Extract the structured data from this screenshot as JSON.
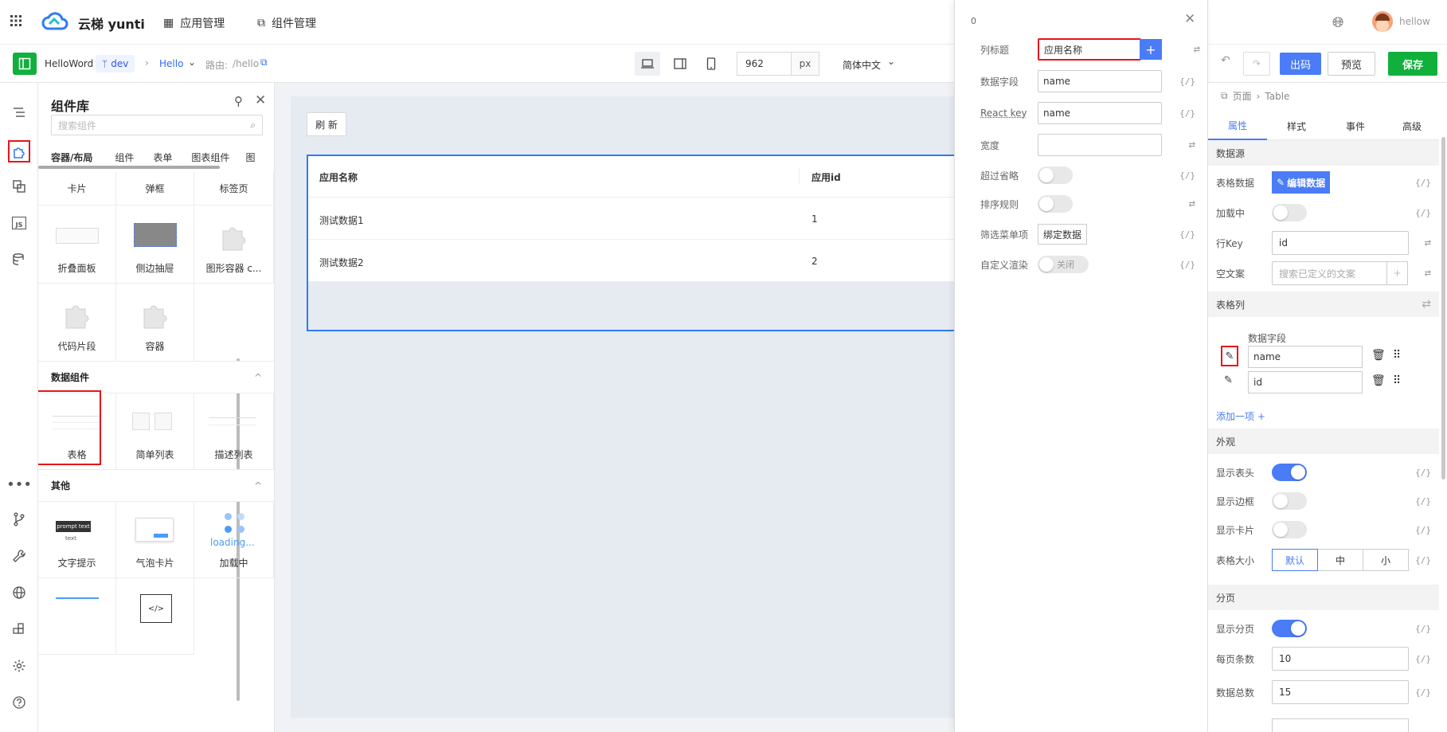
{
  "header": {
    "brand": "云梯 yunti",
    "nav": [
      {
        "label": "应用管理"
      },
      {
        "label": "组件管理"
      }
    ],
    "user": "hellow"
  },
  "subbar": {
    "app": "HelloWord",
    "branch": "dev",
    "page": "Hello",
    "route_label": "路由:",
    "route": "/hello",
    "width_value": "962",
    "unit": "px",
    "language": "简体中文",
    "btn_publish": "出码",
    "btn_preview": "预览",
    "btn_save": "保存"
  },
  "library": {
    "title": "组件库",
    "search_placeholder": "搜索组件",
    "tabs": [
      "容器/布局",
      "组件",
      "表单",
      "图表组件",
      "图"
    ],
    "layout_items": [
      "卡片",
      "弹框",
      "标签页",
      "折叠面板",
      "侧边抽屉",
      "图形容器 c...",
      "代码片段",
      "容器"
    ],
    "data_section": "数据组件",
    "data_items": [
      "表格",
      "简单列表",
      "描述列表"
    ],
    "other_section": "其他",
    "other_items": [
      "文字提示",
      "气泡卡片",
      "加载中"
    ],
    "thumb_prompt": "prompt text",
    "thumb_text": "text",
    "thumb_loading": "loading..."
  },
  "canvas": {
    "refresh": "刷 新",
    "columns": [
      "应用名称",
      "应用id"
    ],
    "rows": [
      [
        "测试数据1",
        "1"
      ],
      [
        "测试数据2",
        "2"
      ]
    ]
  },
  "popover": {
    "index": "0",
    "fields": {
      "title_label": "列标题",
      "title_value": "应用名称",
      "field_label": "数据字段",
      "field_value": "name",
      "key_label": "React key",
      "key_value": "name",
      "width_label": "宽度",
      "ellipsis_label": "超过省略",
      "sort_label": "排序规则",
      "filter_label": "筛选菜单项",
      "filter_btn": "绑定数据",
      "render_label": "自定义渲染",
      "render_toggle": "关闭"
    },
    "code": "{/}"
  },
  "right": {
    "breadcrumb": [
      "页面",
      "Table"
    ],
    "tabs": [
      "属性",
      "样式",
      "事件",
      "高级"
    ],
    "sec_datasource": "数据源",
    "table_data_label": "表格数据",
    "table_data_btn": "编辑数据",
    "loading_label": "加载中",
    "rowkey_label": "行Key",
    "rowkey_value": "id",
    "empty_label": "空文案",
    "empty_placeholder": "搜索已定义的文案",
    "sec_columns": "表格列",
    "col_field_label": "数据字段",
    "columns": [
      "name",
      "id"
    ],
    "add_item": "添加一项 +",
    "sec_appearance": "外观",
    "show_header": "显示表头",
    "show_border": "显示边框",
    "show_card": "显示卡片",
    "size_label": "表格大小",
    "sizes": [
      "默认",
      "中",
      "小"
    ],
    "sec_pagination": "分页",
    "show_pagination": "显示分页",
    "page_size_label": "每页条数",
    "page_size": "10",
    "total_label": "数据总数",
    "total": "15",
    "code": "{/}"
  },
  "colors": {
    "accent": "#4a7cf7",
    "save": "#11b03c",
    "highlight": "#e8141a"
  }
}
